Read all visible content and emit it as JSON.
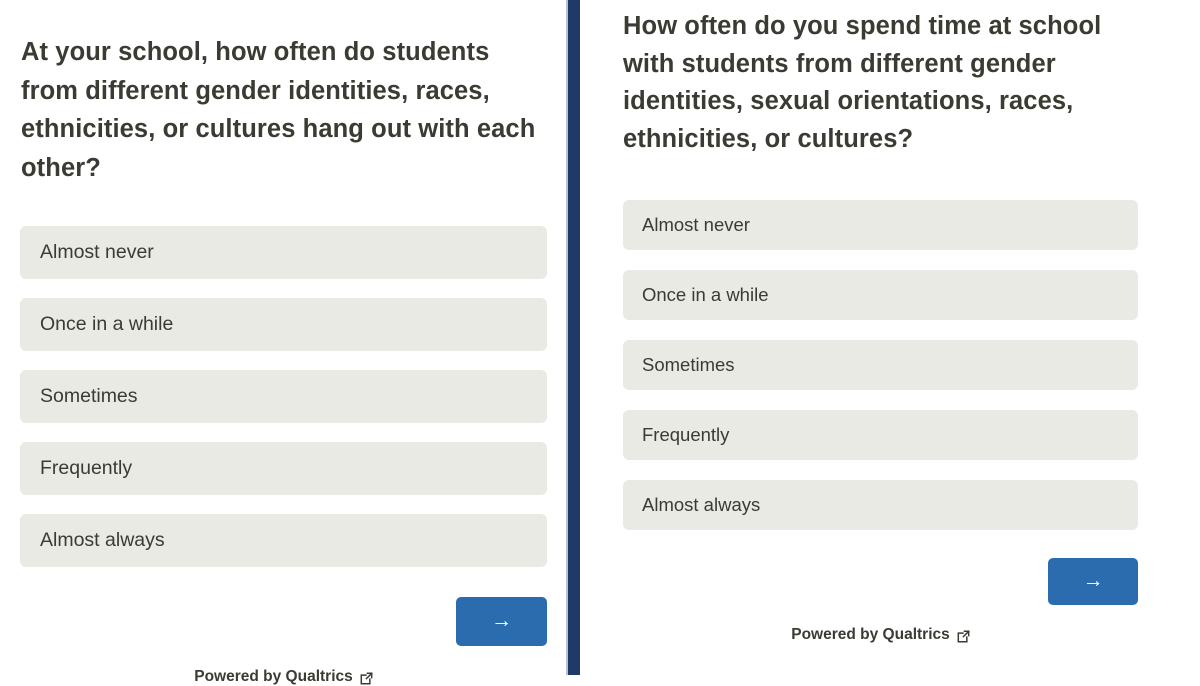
{
  "colors": {
    "divider": "#1f3a68",
    "divider_edge": "#b9c2d2",
    "choice_bg": "#eaeae5",
    "text": "#3b3b33",
    "button_blue": "#2a6cad",
    "page_bg": "#ffffff"
  },
  "left_panel": {
    "question": "At your school, how often do students from different gender identities, races, ethnicities, or cultures hang out with each other?",
    "choices": [
      "Almost never",
      "Once in a while",
      "Sometimes",
      "Frequently",
      "Almost always"
    ],
    "next_button": {
      "icon": "arrow-right-icon",
      "glyph": "→"
    },
    "footer": {
      "text": "Powered by Qualtrics",
      "icon": "external-link-icon"
    }
  },
  "right_panel": {
    "question": "How often do you spend time at school with students from different gender identities, sexual orientations, races, ethnicities, or cultures?",
    "choices": [
      "Almost never",
      "Once in a while",
      "Sometimes",
      "Frequently",
      "Almost always"
    ],
    "next_button": {
      "icon": "arrow-right-icon",
      "glyph": "→"
    },
    "footer": {
      "text": "Powered by Qualtrics",
      "icon": "external-link-icon"
    }
  }
}
